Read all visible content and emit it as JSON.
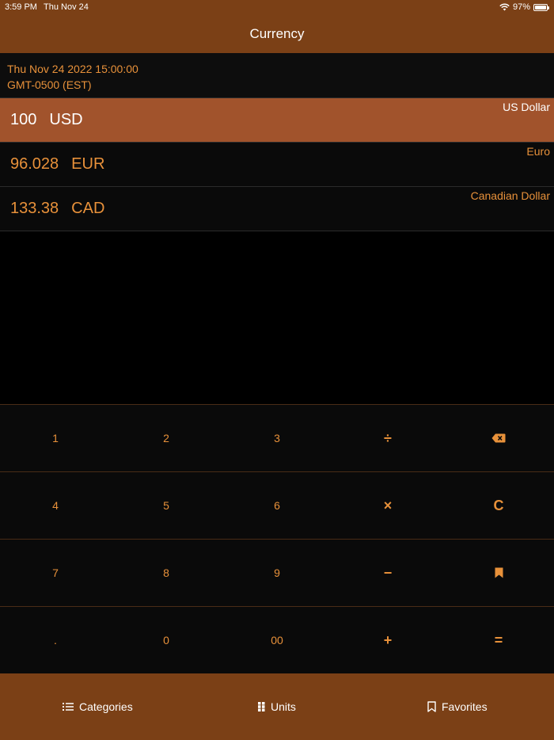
{
  "status": {
    "time": "3:59 PM",
    "date": "Thu Nov 24",
    "battery": "97%",
    "battery_level": 0.97
  },
  "nav": {
    "title": "Currency"
  },
  "rates_date": {
    "line1": "Thu Nov 24 2022 15:00:00",
    "line2": "GMT-0500 (EST)"
  },
  "conversions": [
    {
      "amount": "100",
      "code": "USD",
      "name": "US Dollar",
      "selected": true
    },
    {
      "amount": "96.028",
      "code": "EUR",
      "name": "Euro",
      "selected": false
    },
    {
      "amount": "133.38",
      "code": "CAD",
      "name": "Canadian Dollar",
      "selected": false
    }
  ],
  "keypad": {
    "rows": [
      [
        "1",
        "2",
        "3",
        "÷",
        "backspace-icon"
      ],
      [
        "4",
        "5",
        "6",
        "×",
        "C"
      ],
      [
        "7",
        "8",
        "9",
        "−",
        "bookmark-icon"
      ],
      [
        ".",
        "0",
        "00",
        "+",
        "="
      ]
    ]
  },
  "tabs": [
    {
      "label": "Categories",
      "icon": "list-icon"
    },
    {
      "label": "Units",
      "icon": "grid-icon"
    },
    {
      "label": "Favorites",
      "icon": "bookmark-icon"
    }
  ],
  "colors": {
    "bar": "#7b4016",
    "accent": "#e8913a",
    "selected_row": "#a1532c"
  }
}
